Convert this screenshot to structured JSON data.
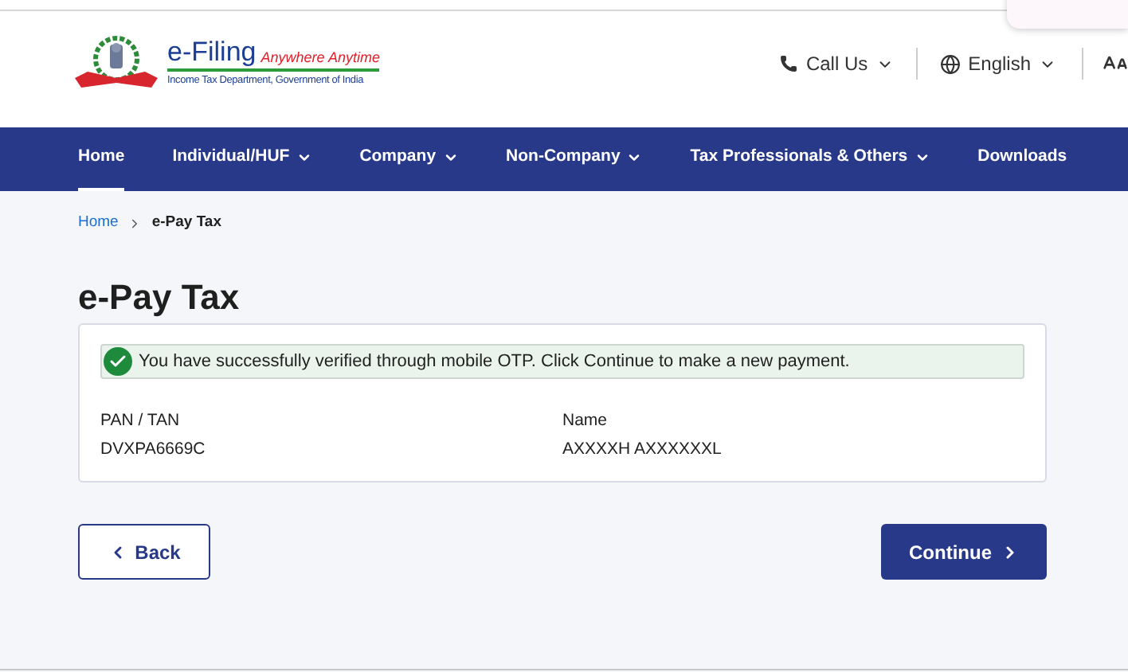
{
  "header": {
    "brand": "e-Filing",
    "tagline": "Anywhere Anytime",
    "department": "Income Tax Department, Government of India",
    "call": "Call Us",
    "language": "English"
  },
  "nav": [
    {
      "label": "Home",
      "selected": true,
      "dropdown": false
    },
    {
      "label": "Individual/HUF",
      "selected": false,
      "dropdown": true
    },
    {
      "label": "Company",
      "selected": false,
      "dropdown": true
    },
    {
      "label": "Non-Company",
      "selected": false,
      "dropdown": true
    },
    {
      "label": "Tax Professionals & Others",
      "selected": false,
      "dropdown": true
    },
    {
      "label": "Downloads",
      "selected": false,
      "dropdown": false
    }
  ],
  "breadcrumb": [
    {
      "label": "Home",
      "link": true
    },
    {
      "label": "e-Pay Tax",
      "link": false
    }
  ],
  "title": "e-Pay Tax",
  "alert": "You have successfully verified through mobile OTP. Click Continue to make a new payment.",
  "fields": [
    {
      "label": "PAN / TAN",
      "value": "DVXPA6669C"
    },
    {
      "label": "Name",
      "value": "AXXXXH AXXXXXXL"
    }
  ],
  "buttons": {
    "back": "Back",
    "continue": "Continue"
  }
}
